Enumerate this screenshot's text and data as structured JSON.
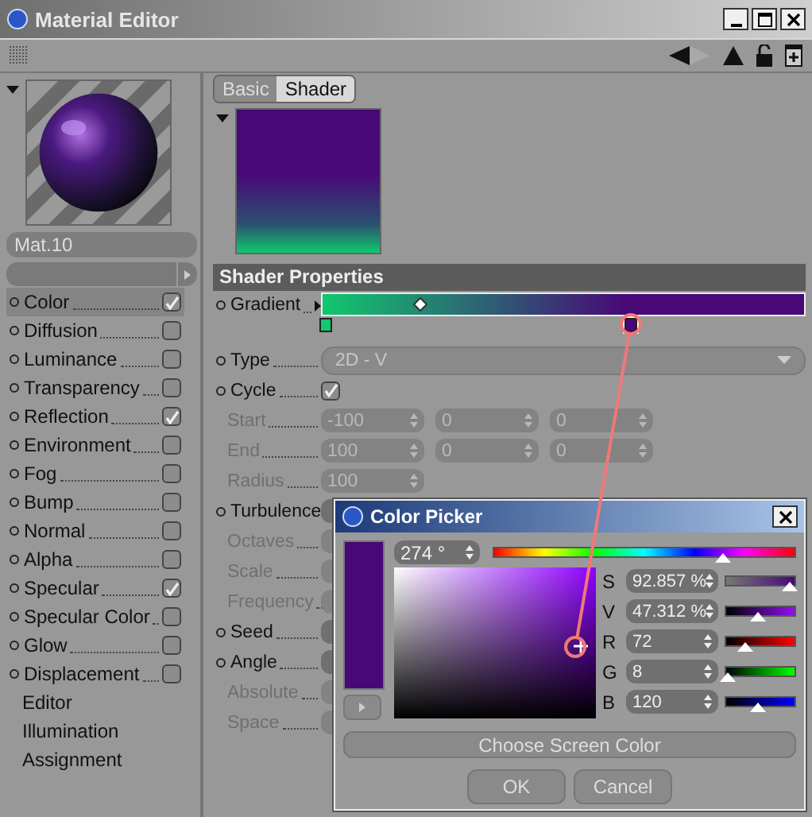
{
  "window": {
    "title": "Material Editor"
  },
  "material": {
    "name": "Mat.10"
  },
  "channels": [
    {
      "label": "Color",
      "kind": "toggle",
      "checked": true,
      "selected": true
    },
    {
      "label": "Diffusion",
      "kind": "toggle",
      "checked": false,
      "selected": false
    },
    {
      "label": "Luminance",
      "kind": "toggle",
      "checked": false,
      "selected": false
    },
    {
      "label": "Transparency",
      "kind": "toggle",
      "checked": false,
      "selected": false
    },
    {
      "label": "Reflection",
      "kind": "toggle",
      "checked": true,
      "selected": false
    },
    {
      "label": "Environment",
      "kind": "toggle",
      "checked": false,
      "selected": false
    },
    {
      "label": "Fog",
      "kind": "toggle",
      "checked": false,
      "selected": false
    },
    {
      "label": "Bump",
      "kind": "toggle",
      "checked": false,
      "selected": false
    },
    {
      "label": "Normal",
      "kind": "toggle",
      "checked": false,
      "selected": false
    },
    {
      "label": "Alpha",
      "kind": "toggle",
      "checked": false,
      "selected": false
    },
    {
      "label": "Specular",
      "kind": "toggle",
      "checked": true,
      "selected": false
    },
    {
      "label": "Specular Color",
      "kind": "toggle",
      "checked": false,
      "selected": false
    },
    {
      "label": "Glow",
      "kind": "toggle",
      "checked": false,
      "selected": false
    },
    {
      "label": "Displacement",
      "kind": "toggle",
      "checked": false,
      "selected": false
    },
    {
      "label": "Editor",
      "kind": "plain",
      "selected": false
    },
    {
      "label": "Illumination",
      "kind": "plain",
      "selected": false
    },
    {
      "label": "Assignment",
      "kind": "plain",
      "selected": false
    }
  ],
  "tabs": [
    {
      "label": "Basic",
      "selected": false
    },
    {
      "label": "Shader",
      "selected": true
    }
  ],
  "section": {
    "title": "Shader Properties"
  },
  "params": [
    {
      "label": "Gradient",
      "kind": "gradient",
      "enabled": true,
      "midpoint": {
        "level": 0.2
      },
      "knots": [
        {
          "color": "#10c86e",
          "selected": false
        },
        {
          "color": "#480878",
          "selected": true
        }
      ]
    },
    {
      "label": "Type",
      "kind": "dropdown",
      "value": "2D - V",
      "enabled": true
    },
    {
      "label": "Cycle",
      "kind": "checkbox",
      "checked": true,
      "enabled": true
    },
    {
      "label": "Start",
      "kind": "spinners",
      "values": [
        "-100",
        "0",
        "0"
      ],
      "enabled": false
    },
    {
      "label": "End",
      "kind": "spinners",
      "values": [
        "100",
        "0",
        "0"
      ],
      "enabled": false
    },
    {
      "label": "Radius",
      "kind": "spinners",
      "values": [
        "100"
      ],
      "enabled": false
    },
    {
      "label": "Turbulence",
      "kind": "field",
      "enabled": true
    },
    {
      "label": "Octaves",
      "kind": "field",
      "enabled": false
    },
    {
      "label": "Scale",
      "kind": "field",
      "enabled": false
    },
    {
      "label": "Frequency",
      "kind": "field",
      "enabled": false
    },
    {
      "label": "Seed",
      "kind": "field",
      "enabled": true
    },
    {
      "label": "Angle",
      "kind": "field",
      "enabled": true
    },
    {
      "label": "Absolute",
      "kind": "field",
      "enabled": false
    },
    {
      "label": "Space",
      "kind": "field",
      "enabled": false
    }
  ],
  "color_picker": {
    "title": "Color Picker",
    "color": "#480878",
    "hue": {
      "value": "274 °",
      "level": 0.76
    },
    "sliders": [
      {
        "label": "S",
        "kind": "saturation",
        "value": "92.857 %",
        "level": 0.93
      },
      {
        "label": "V",
        "kind": "value",
        "value": "47.312 %",
        "level": 0.47
      },
      {
        "label": "R",
        "kind": "red",
        "value": "72",
        "level": 0.28
      },
      {
        "label": "G",
        "kind": "green",
        "value": "8",
        "level": 0.03
      },
      {
        "label": "B",
        "kind": "blue",
        "value": "120",
        "level": 0.47
      }
    ],
    "screen_button": "Choose Screen Color",
    "buttons": [
      "OK",
      "Cancel"
    ]
  }
}
